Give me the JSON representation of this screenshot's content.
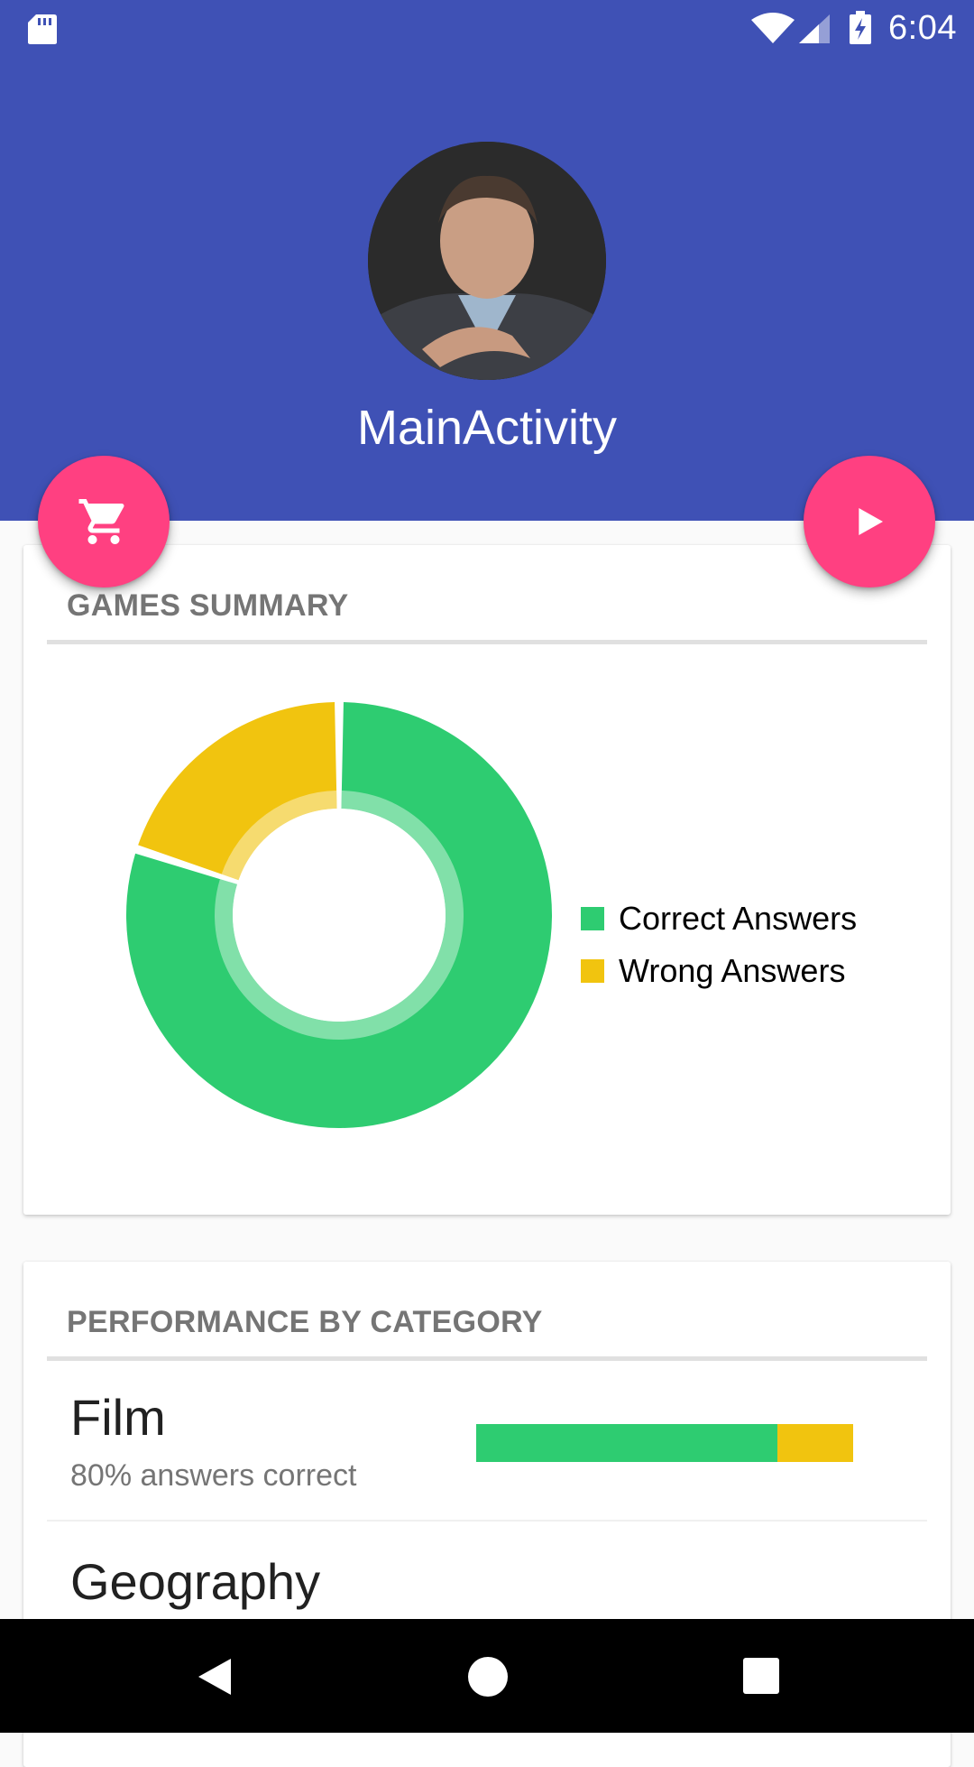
{
  "status_bar": {
    "time": "6:04",
    "icons": [
      "sd-card-icon",
      "wifi-icon",
      "cell-signal-icon",
      "battery-charging-icon"
    ]
  },
  "header": {
    "title": "MainActivity",
    "background_color": "#3f51b5",
    "avatar": "profile-photo"
  },
  "fabs": {
    "left": {
      "icon": "shopping-cart-icon",
      "color": "#ff4081"
    },
    "right": {
      "icon": "play-icon",
      "color": "#ff4081"
    }
  },
  "games_summary": {
    "title": "GAMES SUMMARY",
    "legend": [
      {
        "label": "Correct Answers",
        "color": "#2ecc71"
      },
      {
        "label": "Wrong Answers",
        "color": "#f1c40f"
      }
    ]
  },
  "chart_data": {
    "type": "pie",
    "variant": "donut",
    "labels": [
      "Correct Answers",
      "Wrong Answers"
    ],
    "values": [
      80,
      20
    ],
    "colors": [
      "#2ecc71",
      "#f1c40f"
    ],
    "legend": "right"
  },
  "performance": {
    "title": "PERFORMANCE BY CATEGORY",
    "categories": [
      {
        "name": "Film",
        "subtitle": "80% answers correct",
        "correct_fraction": 0.8
      },
      {
        "name": "Geography",
        "subtitle": "",
        "correct_fraction": null
      }
    ]
  },
  "nav_bar": {
    "icons": [
      "back-icon",
      "home-icon",
      "recents-icon"
    ]
  }
}
